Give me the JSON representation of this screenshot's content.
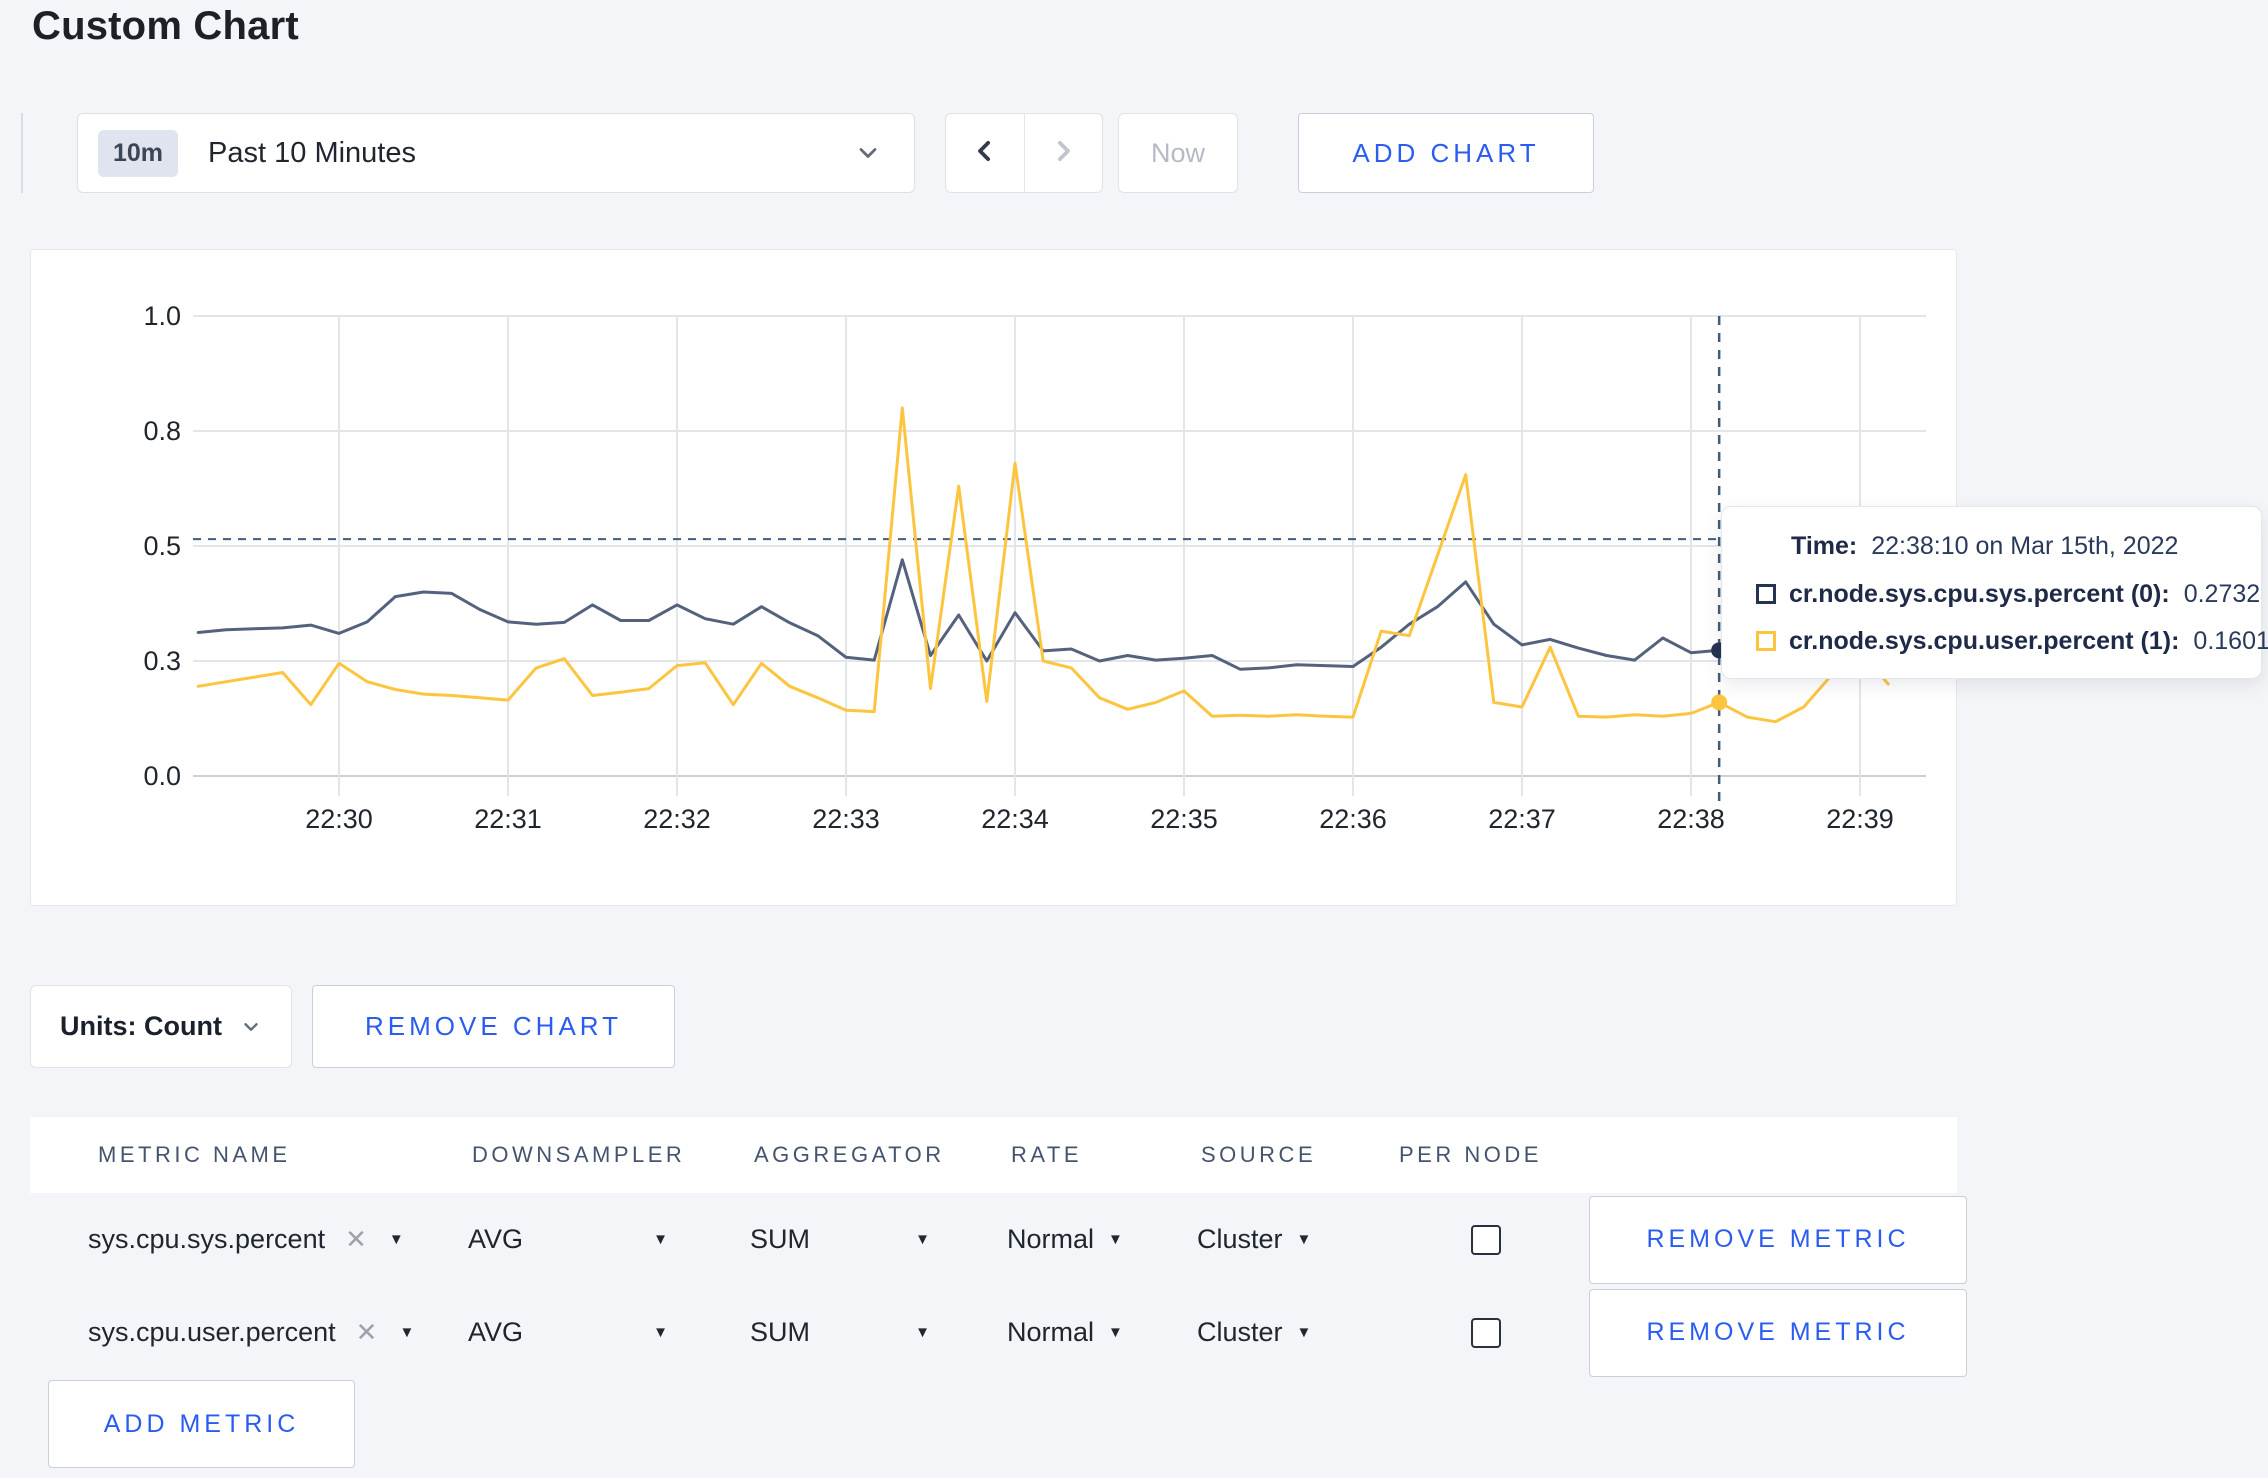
{
  "page": {
    "title": "Custom Chart"
  },
  "toolbar": {
    "time_badge": "10m",
    "time_label": "Past 10 Minutes",
    "now_label": "Now",
    "add_chart_label": "ADD CHART"
  },
  "glyphs": {
    "caret_down": "▼",
    "clear_x": "✕"
  },
  "colors": {
    "accent_blue": "#2b5cf0",
    "series_sys": "#54627e",
    "series_user": "#fdc53f",
    "swatch_sys": "#26334f",
    "swatch_user": "#fdc53f",
    "crosshair": "#3f5d7c",
    "grid": "#e4e5e9",
    "baseline": "#cdd0d6"
  },
  "chart_data": {
    "type": "line",
    "title": "",
    "xlabel": "",
    "ylabel": "",
    "ylim": [
      0,
      1
    ],
    "grid": true,
    "legend_position": "tooltip",
    "x_start": "22:29:10",
    "x_step_seconds": 10,
    "x_ticks": [
      "22:30",
      "22:31",
      "22:32",
      "22:33",
      "22:34",
      "22:35",
      "22:36",
      "22:37",
      "22:38",
      "22:39"
    ],
    "y_tick_values": [
      0,
      0.25,
      0.5,
      0.75,
      1.0
    ],
    "y_tick_labels": [
      "0.0",
      "0.3",
      "0.5",
      "0.8",
      "1.0"
    ],
    "series": [
      {
        "name": "cr.node.sys.cpu.sys.percent (0)",
        "color": "#54627e",
        "values": [
          0.312,
          0.318,
          0.32,
          0.322,
          0.328,
          0.31,
          0.335,
          0.39,
          0.4,
          0.397,
          0.362,
          0.335,
          0.33,
          0.334,
          0.372,
          0.338,
          0.338,
          0.372,
          0.342,
          0.33,
          0.368,
          0.333,
          0.305,
          0.258,
          0.252,
          0.47,
          0.262,
          0.35,
          0.25,
          0.355,
          0.272,
          0.276,
          0.25,
          0.262,
          0.252,
          0.256,
          0.262,
          0.232,
          0.235,
          0.242,
          0.24,
          0.238,
          0.28,
          0.33,
          0.368,
          0.422,
          0.33,
          0.285,
          0.297,
          0.278,
          0.262,
          0.252,
          0.3,
          0.268,
          0.2732,
          0.262,
          0.268,
          0.262,
          0.266,
          0.26,
          0.262
        ]
      },
      {
        "name": "cr.node.sys.cpu.user.percent (1)",
        "color": "#fdc53f",
        "values": [
          0.195,
          0.205,
          0.215,
          0.225,
          0.155,
          0.245,
          0.205,
          0.188,
          0.178,
          0.175,
          0.17,
          0.165,
          0.235,
          0.255,
          0.175,
          0.182,
          0.19,
          0.24,
          0.246,
          0.155,
          0.245,
          0.195,
          0.17,
          0.143,
          0.14,
          0.8,
          0.19,
          0.63,
          0.162,
          0.68,
          0.25,
          0.235,
          0.17,
          0.145,
          0.16,
          0.185,
          0.13,
          0.132,
          0.13,
          0.133,
          0.13,
          0.128,
          0.315,
          0.305,
          0.48,
          0.655,
          0.16,
          0.15,
          0.28,
          0.13,
          0.128,
          0.133,
          0.13,
          0.136,
          0.1601,
          0.128,
          0.118,
          0.15,
          0.22,
          0.272,
          0.2
        ]
      }
    ],
    "crosshair": {
      "time": "22:38:10",
      "index": 54,
      "hline_value": 0.515
    }
  },
  "tooltip": {
    "time_label": "Time:",
    "time_value": "22:38:10 on Mar 15th, 2022",
    "rows": [
      {
        "label": "cr.node.sys.cpu.sys.percent (0):",
        "value": "0.2732",
        "color": "#26334f"
      },
      {
        "label": "cr.node.sys.cpu.user.percent (1):",
        "value": "0.1601",
        "color": "#fdc53f"
      }
    ]
  },
  "chart_controls": {
    "units_label": "Units: Count",
    "remove_chart_label": "REMOVE CHART"
  },
  "metrics_table": {
    "headers": [
      "METRIC NAME",
      "DOWNSAMPLER",
      "AGGREGATOR",
      "RATE",
      "SOURCE",
      "PER NODE"
    ],
    "rows": [
      {
        "metric": "sys.cpu.sys.percent",
        "downsampler": "AVG",
        "aggregator": "SUM",
        "rate": "Normal",
        "source": "Cluster",
        "per_node": false,
        "remove_label": "REMOVE METRIC"
      },
      {
        "metric": "sys.cpu.user.percent",
        "downsampler": "AVG",
        "aggregator": "SUM",
        "rate": "Normal",
        "source": "Cluster",
        "per_node": false,
        "remove_label": "REMOVE METRIC"
      }
    ],
    "add_metric_label": "ADD METRIC"
  }
}
